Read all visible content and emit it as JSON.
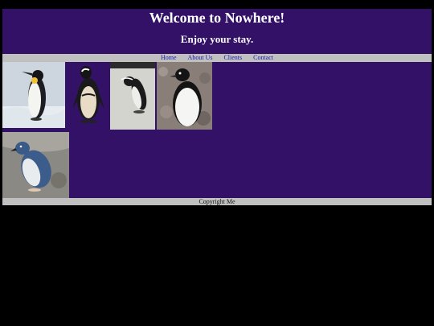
{
  "header": {
    "title": "Welcome to Nowhere!",
    "subtitle": "Enjoy your stay."
  },
  "nav": {
    "items": [
      {
        "label": "Home"
      },
      {
        "label": "About Us"
      },
      {
        "label": "Clients"
      },
      {
        "label": "Contact"
      }
    ]
  },
  "gallery": {
    "images": [
      {
        "name": "emperor-penguin-image"
      },
      {
        "name": "african-penguin-image"
      },
      {
        "name": "walking-penguin-image"
      },
      {
        "name": "adelie-penguin-image"
      },
      {
        "name": "little-blue-penguin-image"
      }
    ]
  },
  "footer": {
    "text": "Copyright Me"
  },
  "colors": {
    "background": "#000000",
    "header_bg": "#331166",
    "bar_bg": "#c0c0c0",
    "link": "#1a1aa8"
  }
}
